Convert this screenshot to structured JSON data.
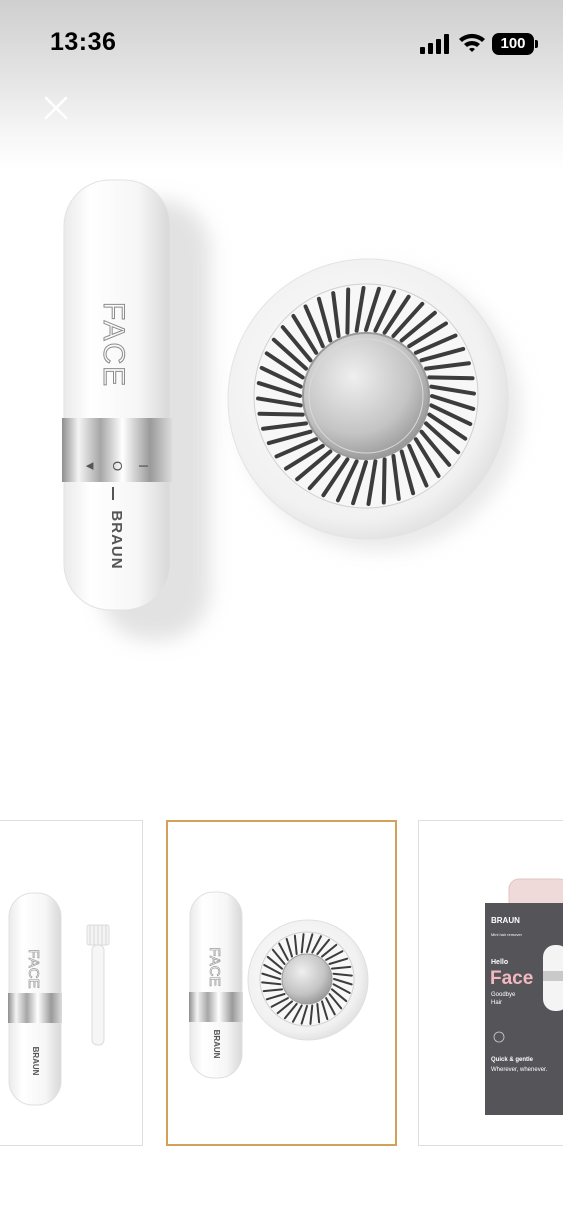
{
  "status_bar": {
    "time": "13:36",
    "battery": "100",
    "icons": [
      "signal-icon",
      "wifi-icon",
      "battery-icon"
    ]
  },
  "viewer": {
    "close_icon": "close-icon",
    "main_image": {
      "device_label": "FACE",
      "brand": "BRAUN",
      "switch_marks": [
        "I",
        "O",
        "▼"
      ]
    },
    "thumbnails": [
      {
        "name": "thumbnail-trimmer-with-brush",
        "label": "FACE",
        "brand": "BRAUN",
        "selected": false
      },
      {
        "name": "thumbnail-trimmer-with-head",
        "label": "FACE",
        "brand": "BRAUN",
        "selected": true
      },
      {
        "name": "thumbnail-packaging",
        "selected": false,
        "package": {
          "brand": "BRAUN",
          "subtitle": "Mini hair remover",
          "hello": "Hello",
          "face": "Face",
          "goodbye_line1": "Goodbye",
          "goodbye_line2": "Hair",
          "tagline1": "Quick & gentle",
          "tagline2": "Wherever, whenever."
        }
      }
    ]
  },
  "colors": {
    "accent_selected_border": "#d4a15b",
    "package_background": "#555459",
    "package_tab": "#f0d9d9"
  }
}
